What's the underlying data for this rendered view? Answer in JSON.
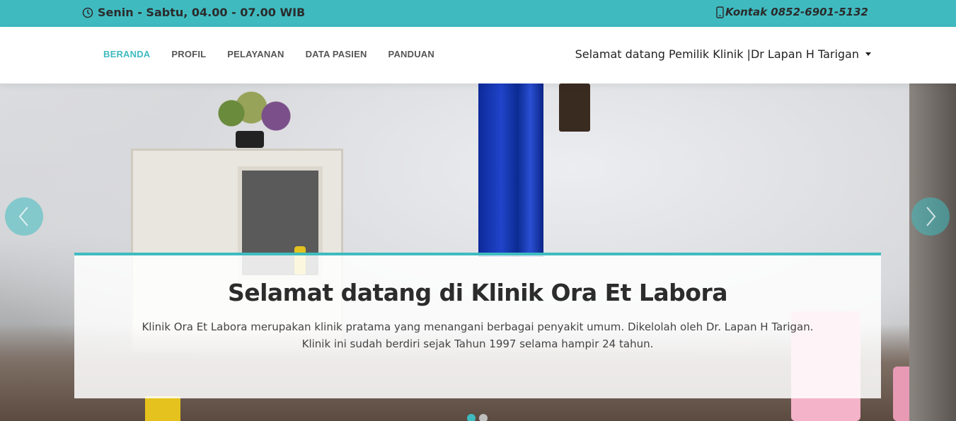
{
  "topbar": {
    "hours_icon": "clock-icon",
    "hours_text": "Senin - Sabtu, 04.00 - 07.00 WIB",
    "contact_icon": "phone-icon",
    "contact_text": "Kontak 0852-6901-5132",
    "background_color": "#3fbbc0"
  },
  "nav": {
    "items": [
      {
        "label": "BERANDA",
        "active": true
      },
      {
        "label": "PROFIL",
        "active": false
      },
      {
        "label": "PELAYANAN",
        "active": false
      },
      {
        "label": "DATA PASIEN",
        "active": false
      },
      {
        "label": "PANDUAN",
        "active": false
      }
    ],
    "user_greeting": "Selamat datang Pemilik Klinik |Dr Lapan H Tarigan",
    "accent_color": "#3fbbc0"
  },
  "hero": {
    "title": "Selamat datang di Klinik Ora Et Labora",
    "description_line1": "Klinik Ora Et Labora merupakan klinik pratama yang menangani berbagai penyakit umum. Dikelolah oleh Dr. Lapan H Tarigan.",
    "description_line2": "Klinik ini sudah berdiri sejak Tahun 1997 selama hampir 24 tahun.",
    "prev_icon": "chevron-left-icon",
    "next_icon": "chevron-right-icon",
    "slide_count": 2,
    "active_slide": 1
  }
}
